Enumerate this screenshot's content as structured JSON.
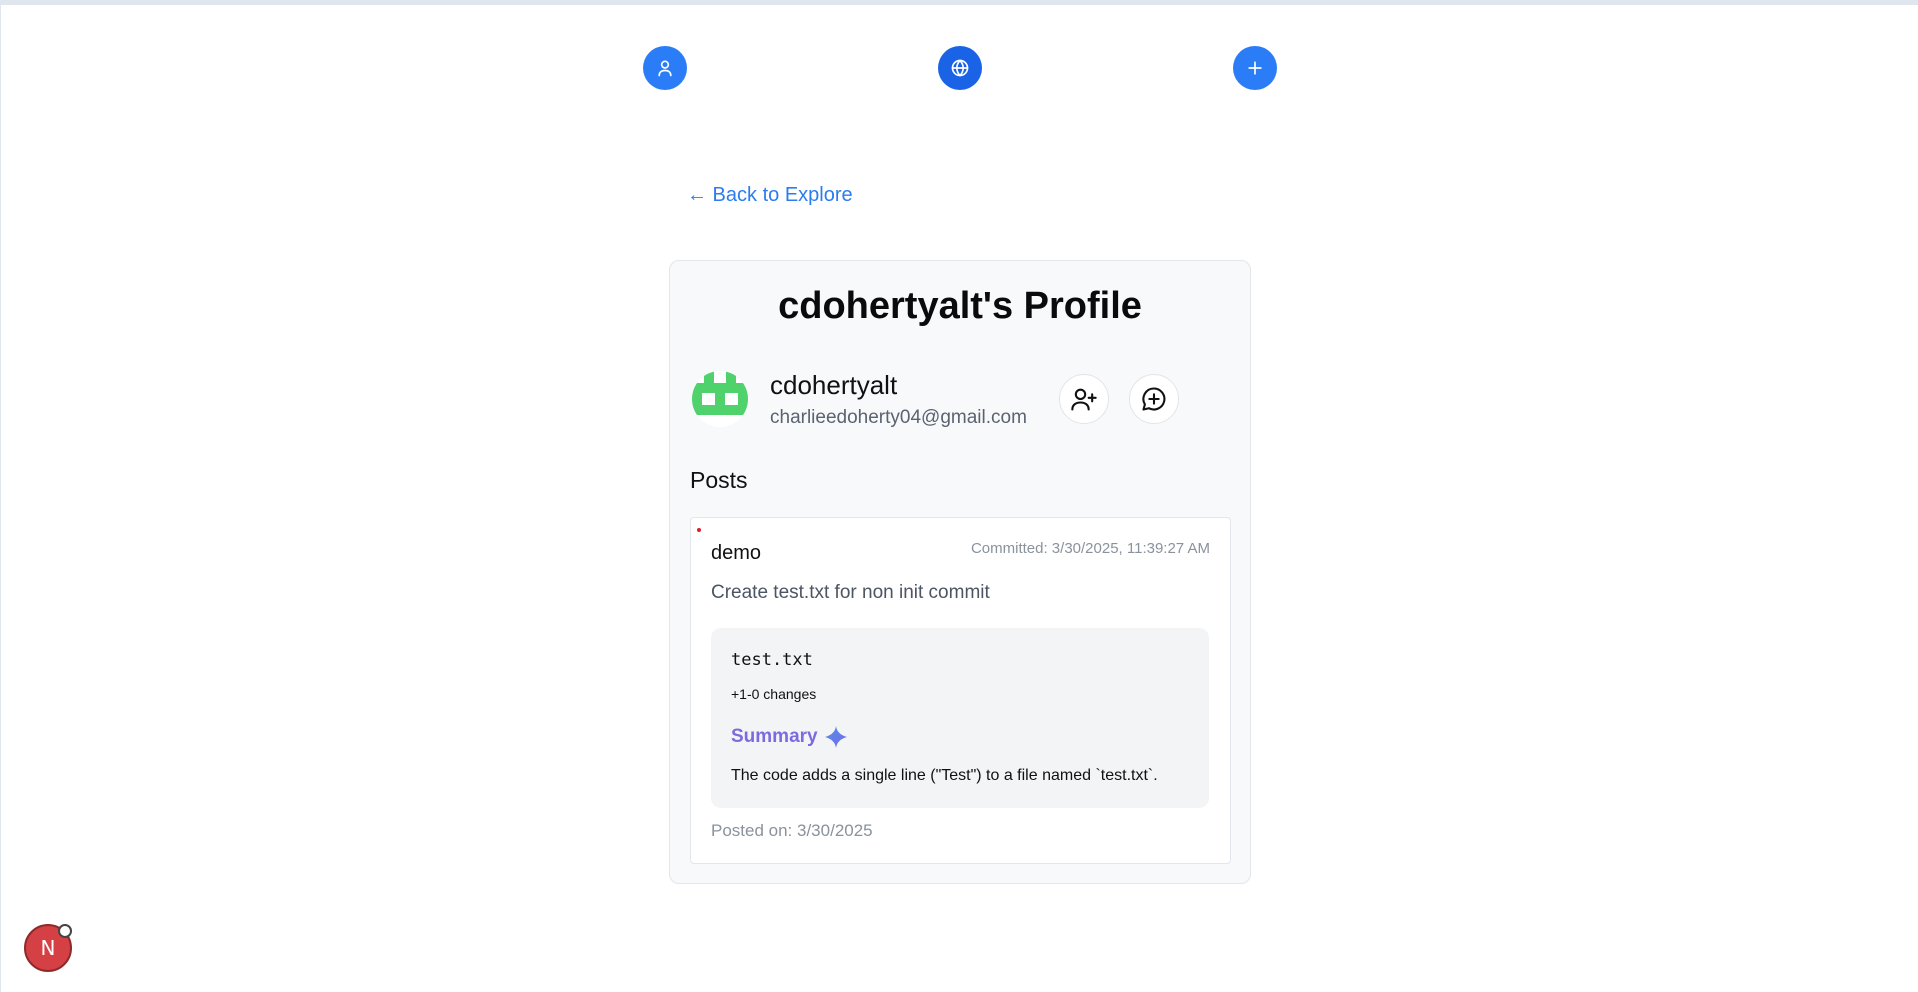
{
  "nav": {
    "items": [
      {
        "name": "profile",
        "icon": "user-icon"
      },
      {
        "name": "explore",
        "icon": "globe-icon"
      },
      {
        "name": "add",
        "icon": "plus-icon"
      }
    ]
  },
  "back_link": "← Back to Explore",
  "profile": {
    "title": "cdohertyalt's Profile",
    "username": "cdohertyalt",
    "email": "charlieedoherty04@gmail.com",
    "avatar_icon": "identicon-avatar",
    "actions": [
      {
        "name": "add-friend",
        "icon": "user-plus-icon"
      },
      {
        "name": "message",
        "icon": "message-plus-icon"
      }
    ]
  },
  "posts": {
    "heading": "Posts",
    "items": [
      {
        "repo": "demo",
        "committed": "Committed: 3/30/2025, 11:39:27 AM",
        "message": "Create test.txt for non init commit",
        "file": {
          "name": "test.txt",
          "changes": "+1-0 changes",
          "summary_label": "Summary",
          "summary_text": "The code adds a single line (\"Test\") to a file named `test.txt`."
        },
        "posted_on": "Posted on: 3/30/2025"
      }
    ]
  },
  "dev_badge": {
    "label": "N"
  },
  "colors": {
    "accent": "#2b7df7",
    "link": "#2b7cf0",
    "summary": "#7c6be0",
    "avatar_green": "#4fd16b",
    "badge_red": "#d44043"
  }
}
